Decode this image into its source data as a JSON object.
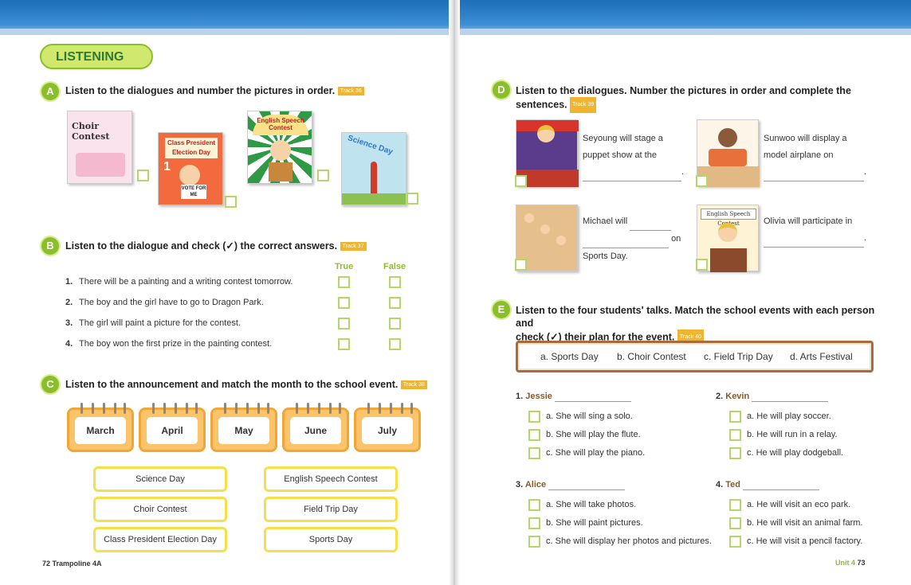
{
  "left_page": {
    "section_title": "LISTENING",
    "A": {
      "label": "A",
      "instruction": "Listen to the dialogues and number the pictures in order.",
      "track": "Track 36",
      "pictures": [
        "Choir Contest",
        "Class President Election Day",
        "English Speech Contest",
        "Science Day"
      ],
      "vote_sign": "VOTE FOR ME",
      "number": "1"
    },
    "B": {
      "label": "B",
      "instruction": "Listen to the dialogue and check (✓) the correct answers.",
      "track": "Track 37",
      "true_label": "True",
      "false_label": "False",
      "items": [
        {
          "num": "1.",
          "text": "There will be a painting and a writing contest tomorrow."
        },
        {
          "num": "2.",
          "text": "The boy and the girl have to go to Dragon Park."
        },
        {
          "num": "3.",
          "text": "The girl will paint a picture for the contest."
        },
        {
          "num": "4.",
          "text": "The boy won the first prize in the painting contest."
        }
      ]
    },
    "C": {
      "label": "C",
      "instruction": "Listen to the announcement and match the month to the school event.",
      "track": "Track 38",
      "months": [
        "March",
        "April",
        "May",
        "June",
        "July"
      ],
      "events": [
        "Science Day",
        "English Speech Contest",
        "Choir Contest",
        "Field Trip Day",
        "Class President Election Day",
        "Sports Day"
      ]
    },
    "footer": "72 Trampoline 4A"
  },
  "right_page": {
    "D": {
      "label": "D",
      "instruction_line1": "Listen to the dialogues. Number the pictures in order and complete the",
      "instruction_line2": "sentences.",
      "track": "Track 39",
      "items": [
        {
          "l1": "Seyoung will stage a",
          "l2": "puppet show at the",
          "l3": "."
        },
        {
          "l1": "Sunwoo will display a",
          "l2": "model airplane on",
          "l3": "."
        },
        {
          "l1": "Michael will",
          "l2": "on",
          "l3": "Sports Day."
        },
        {
          "l1": "Olivia will participate in",
          "l2": "",
          "l3": "."
        }
      ],
      "sign": "English Speech Contest"
    },
    "E": {
      "label": "E",
      "instruction_line1": "Listen to the four students' talks. Match the school events with each person and",
      "instruction_line2": "check (✓) their plan for the event.",
      "track": "Track 40",
      "options": [
        "a. Sports Day",
        "b. Choir Contest",
        "c. Field Trip Day",
        "d. Arts Festival"
      ],
      "people": [
        {
          "num": "1.",
          "name": "Jessie",
          "plans": [
            "a. She will sing a solo.",
            "b. She will play the flute.",
            "c. She will play the piano."
          ]
        },
        {
          "num": "2.",
          "name": "Kevin",
          "plans": [
            "a. He will play soccer.",
            "b. He will run in a relay.",
            "c. He will play dodgeball."
          ]
        },
        {
          "num": "3.",
          "name": "Alice",
          "plans": [
            "a. She will take photos.",
            "b. She will paint pictures.",
            "c. She will display her photos and pictures."
          ]
        },
        {
          "num": "4.",
          "name": "Ted",
          "plans": [
            "a. He will visit an eco park.",
            "b. He will visit an animal farm.",
            "c. He will visit a pencil factory."
          ]
        }
      ]
    },
    "footer_unit": "Unit 4",
    "footer_page": "73"
  },
  "colors": {
    "accent_green": "#8bbf2a",
    "header_blue": "#1d6fb8",
    "calendar_orange": "#fbc46a",
    "event_yellow": "#f5e04a",
    "track_orange": "#f0b52c"
  }
}
